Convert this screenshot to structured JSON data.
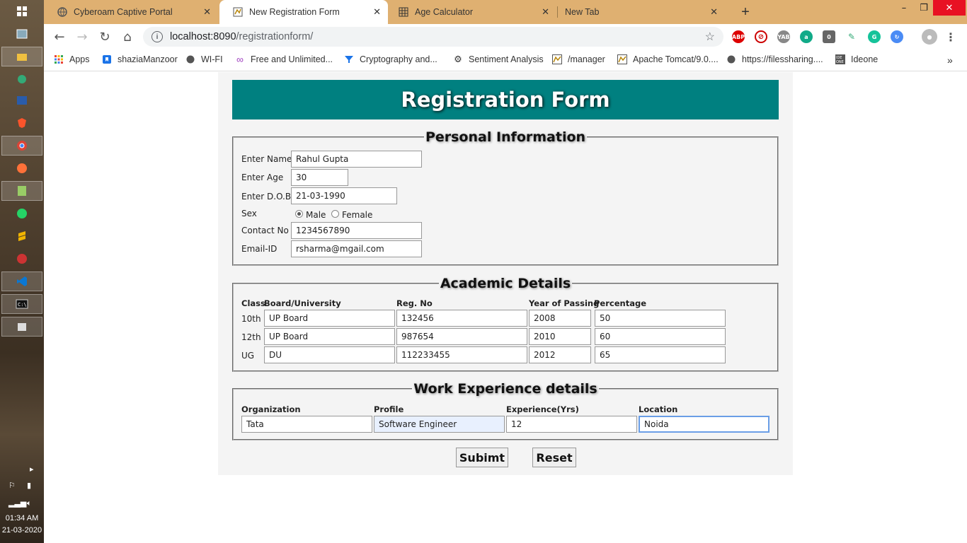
{
  "taskbar": {
    "time": "01:34 AM",
    "date": "21-03-2020"
  },
  "tabs": [
    {
      "title": "Cyberoam Captive Portal",
      "icon": "globe-icon",
      "active": false
    },
    {
      "title": "New Registration Form",
      "icon": "tomcat-icon",
      "active": true
    },
    {
      "title": "Age Calculator",
      "icon": "calculator-icon",
      "active": false
    },
    {
      "title": "New Tab",
      "icon": "",
      "active": false
    }
  ],
  "omnibox": {
    "host": "localhost:8090",
    "path": "/registrationform/"
  },
  "bookmarks": [
    {
      "label": "Apps",
      "icon": "apps-grid-icon"
    },
    {
      "label": "shaziaManzoor",
      "icon": "bookmark-icon"
    },
    {
      "label": "WI-FI",
      "icon": "globe-icon"
    },
    {
      "label": "Free and Unlimited...",
      "icon": "infinity-icon"
    },
    {
      "label": "Cryptography and...",
      "icon": "funnel-icon"
    },
    {
      "label": "Sentiment Analysis",
      "icon": "gear-icon"
    },
    {
      "label": "/manager",
      "icon": "tomcat-icon"
    },
    {
      "label": "Apache Tomcat/9.0....",
      "icon": "tomcat-icon"
    },
    {
      "label": "https://filessharing....",
      "icon": "globe-icon"
    },
    {
      "label": "Ideone",
      "icon": "ideone-icon"
    }
  ],
  "form": {
    "title": "Registration Form",
    "personal": {
      "legend": "Personal Information",
      "name_label": "Enter Name",
      "name_value": "Rahul Gupta",
      "age_label": "Enter Age",
      "age_value": "30",
      "dob_label": "Enter D.O.B",
      "dob_value": "21-03-1990",
      "sex_label": "Sex",
      "sex_options": [
        "Male",
        "Female"
      ],
      "sex_selected": "Male",
      "contact_label": "Contact No",
      "contact_value": "1234567890",
      "email_label": "Email-ID",
      "email_value": "rsharma@mgail.com"
    },
    "academic": {
      "legend": "Academic Details",
      "headers": [
        "Class",
        "Board/University",
        "Reg. No",
        "Year of Passing",
        "Percentage"
      ],
      "rows": [
        {
          "class": "10th",
          "board": "UP Board",
          "reg": "132456",
          "year": "2008",
          "percentage": "50"
        },
        {
          "class": "12th",
          "board": "UP Board",
          "reg": "987654",
          "year": "2010",
          "percentage": "60"
        },
        {
          "class": "UG",
          "board": "DU",
          "reg": "112233455",
          "year": "2012",
          "percentage": "65"
        }
      ]
    },
    "work": {
      "legend": "Work Experience details",
      "headers": [
        "Organization",
        "Profile",
        "Experience(Yrs)",
        "Location"
      ],
      "values": [
        "Tata",
        "Software Engineer",
        "12",
        "Noida"
      ]
    },
    "submit_label": "Subimt",
    "reset_label": "Reset"
  }
}
